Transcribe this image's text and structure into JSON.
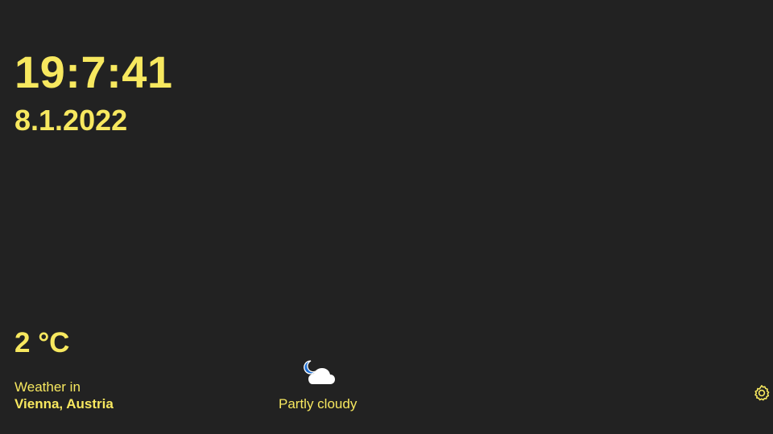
{
  "clock": {
    "time": "19:7:41",
    "date": "8.1.2022"
  },
  "weather": {
    "temperature": "2 °C",
    "label": "Weather in",
    "location": "Vienna, Austria",
    "condition": "Partly cloudy",
    "condition_icon": "partly-cloudy-night-icon"
  },
  "controls": {
    "settings_icon": "gear-icon"
  },
  "colors": {
    "background": "#222222",
    "text": "#f7e85f",
    "moon": "#1f6fd1",
    "cloud": "#ffffff"
  }
}
